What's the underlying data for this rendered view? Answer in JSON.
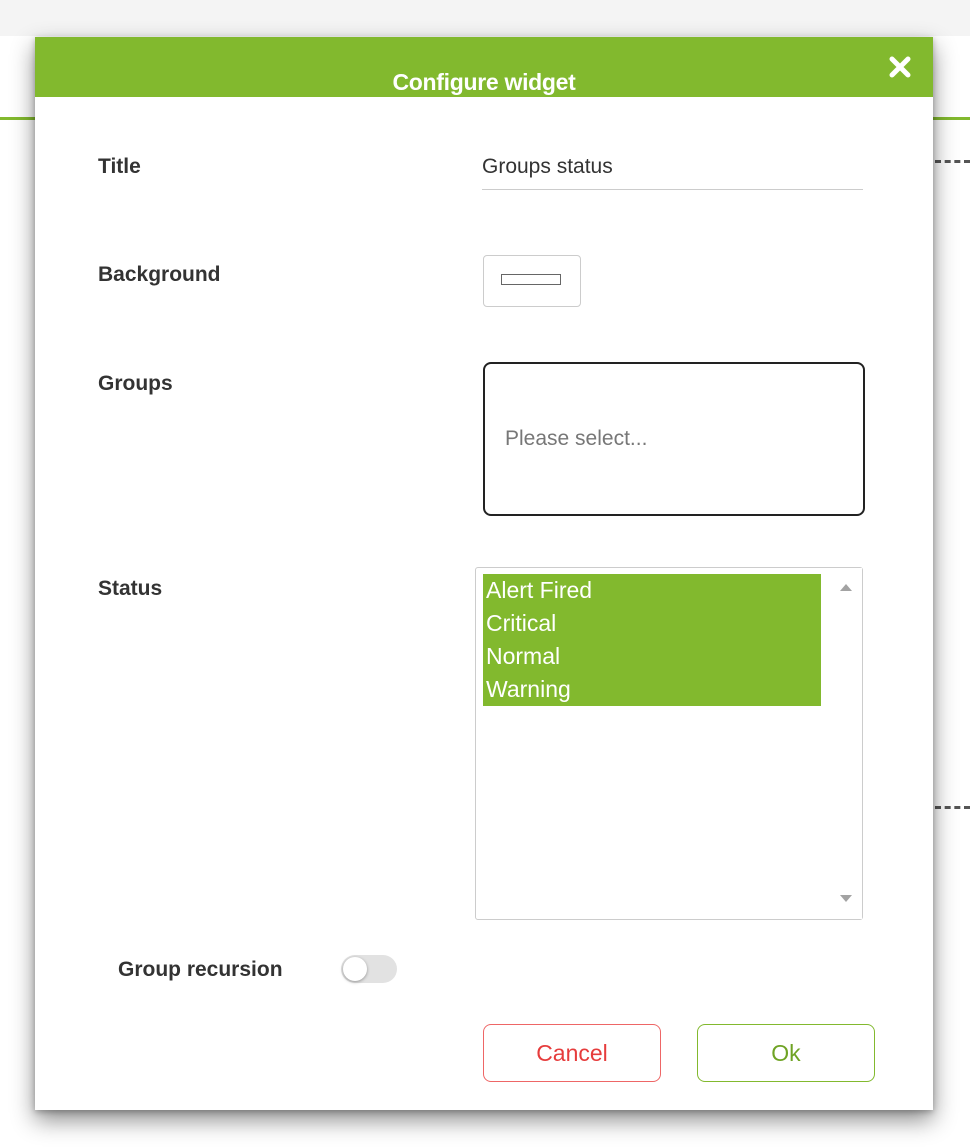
{
  "dialog": {
    "title": "Configure widget",
    "close_icon": "close-icon"
  },
  "form": {
    "title_label": "Title",
    "title_value": "Groups status",
    "background_label": "Background",
    "background_color": "#ffffff",
    "groups_label": "Groups",
    "groups_placeholder": "Please select...",
    "status_label": "Status",
    "status_options": [
      "Alert Fired",
      "Critical",
      "Normal",
      "Warning"
    ],
    "status_selected": [
      "Alert Fired",
      "Critical",
      "Normal",
      "Warning"
    ],
    "recursion_label": "Group recursion",
    "recursion_enabled": false
  },
  "buttons": {
    "cancel": "Cancel",
    "ok": "Ok"
  },
  "colors": {
    "accent": "#82b92e",
    "cancel": "#e63c3c",
    "ok": "#6fa324"
  }
}
